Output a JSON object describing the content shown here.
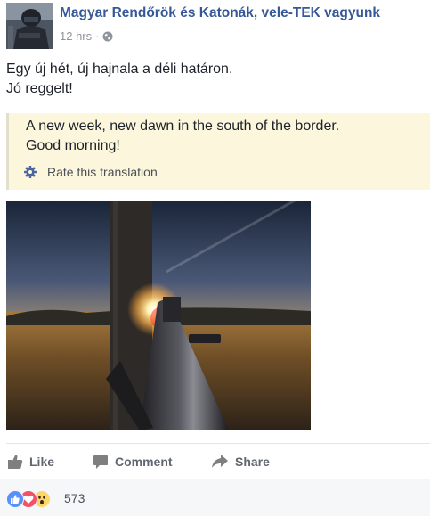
{
  "post": {
    "page_name": "Magyar Rendőrök és Katonák, vele-TEK vagyunk",
    "timestamp": "12 hrs",
    "separator": "·",
    "audience_icon": "globe-icon",
    "text_lines": [
      "Egy új hét, új hajnala a déli határon.",
      "Jó reggelt!"
    ]
  },
  "translation": {
    "lines": [
      "A new week, new dawn in the south of the border.",
      "Good morning!"
    ],
    "rate_label": "Rate this translation",
    "rate_icon": "gear-icon"
  },
  "actions": {
    "like": {
      "label": "Like",
      "icon": "thumbs-up-icon"
    },
    "comment": {
      "label": "Comment",
      "icon": "comment-icon"
    },
    "share": {
      "label": "Share",
      "icon": "share-arrow-icon"
    }
  },
  "reactions": {
    "icons": [
      "like-reaction-icon",
      "love-reaction-icon",
      "wow-reaction-icon"
    ],
    "count": "573"
  },
  "colors": {
    "link_blue": "#365899",
    "translation_bg": "#fbf6dc",
    "like_blue": "#5890ff",
    "love_red": "#f25268",
    "wow_yellow": "#fcd669"
  }
}
